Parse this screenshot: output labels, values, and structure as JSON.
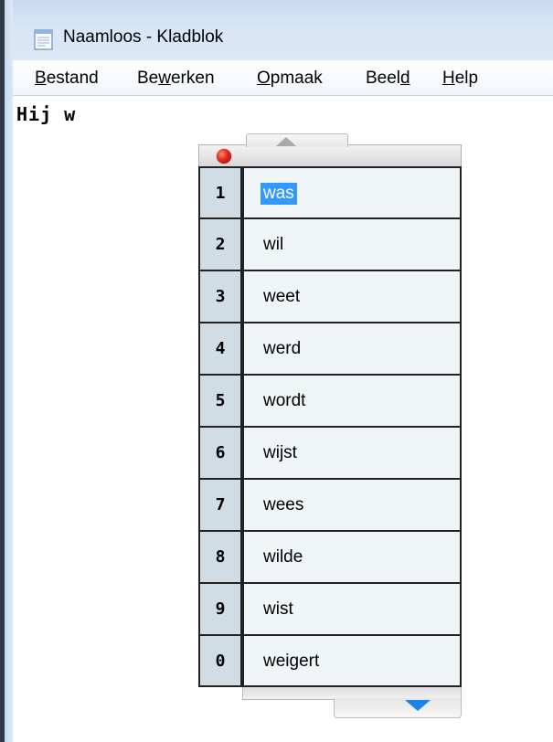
{
  "window": {
    "title": "Naamloos - Kladblok",
    "icon": "notepad-icon"
  },
  "menu": {
    "items": [
      {
        "pre": "",
        "ul": "B",
        "post": "estand"
      },
      {
        "pre": "Be",
        "ul": "w",
        "post": "erken"
      },
      {
        "pre": "",
        "ul": "O",
        "post": "pmaak"
      },
      {
        "pre": "Beel",
        "ul": "d",
        "post": ""
      },
      {
        "pre": "",
        "ul": "H",
        "post": "elp"
      }
    ]
  },
  "editor": {
    "text": "Hij w"
  },
  "suggestions": {
    "selected_index": 0,
    "items": [
      {
        "key": "1",
        "word": "was"
      },
      {
        "key": "2",
        "word": "wil"
      },
      {
        "key": "3",
        "word": "weet"
      },
      {
        "key": "4",
        "word": "werd"
      },
      {
        "key": "5",
        "word": "wordt"
      },
      {
        "key": "6",
        "word": "wijst"
      },
      {
        "key": "7",
        "word": "wees"
      },
      {
        "key": "8",
        "word": "wilde"
      },
      {
        "key": "9",
        "word": "wist"
      },
      {
        "key": "0",
        "word": "weigert"
      }
    ],
    "colors": {
      "selection": "#3399ff",
      "number_cell": "#d1dde5",
      "word_cell": "#f0f6f8",
      "scroll_down_arrow": "#1c84e8",
      "record_dot": "#e2241b"
    },
    "icons": {
      "record": "record-dot-icon",
      "up": "scroll-up-arrow-icon",
      "down": "scroll-down-arrow-icon"
    }
  }
}
